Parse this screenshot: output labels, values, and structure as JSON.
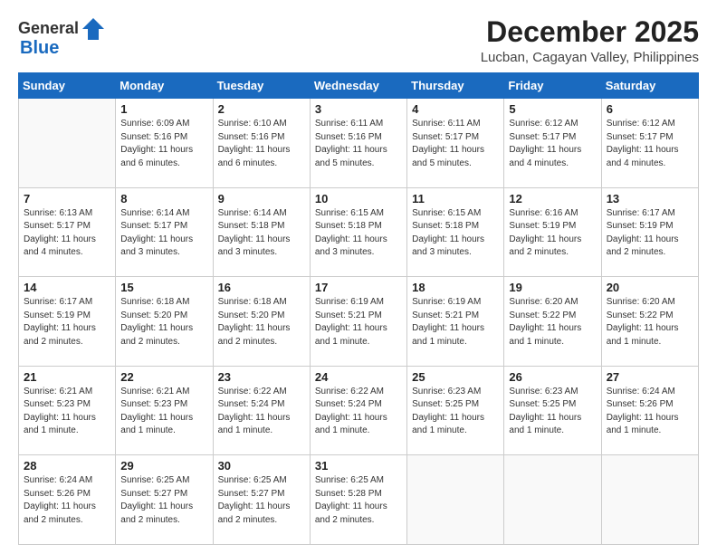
{
  "logo": {
    "general": "General",
    "blue": "Blue"
  },
  "title": "December 2025",
  "location": "Lucban, Cagayan Valley, Philippines",
  "weekdays": [
    "Sunday",
    "Monday",
    "Tuesday",
    "Wednesday",
    "Thursday",
    "Friday",
    "Saturday"
  ],
  "weeks": [
    [
      {
        "day": "",
        "info": ""
      },
      {
        "day": "1",
        "info": "Sunrise: 6:09 AM\nSunset: 5:16 PM\nDaylight: 11 hours\nand 6 minutes."
      },
      {
        "day": "2",
        "info": "Sunrise: 6:10 AM\nSunset: 5:16 PM\nDaylight: 11 hours\nand 6 minutes."
      },
      {
        "day": "3",
        "info": "Sunrise: 6:11 AM\nSunset: 5:16 PM\nDaylight: 11 hours\nand 5 minutes."
      },
      {
        "day": "4",
        "info": "Sunrise: 6:11 AM\nSunset: 5:17 PM\nDaylight: 11 hours\nand 5 minutes."
      },
      {
        "day": "5",
        "info": "Sunrise: 6:12 AM\nSunset: 5:17 PM\nDaylight: 11 hours\nand 4 minutes."
      },
      {
        "day": "6",
        "info": "Sunrise: 6:12 AM\nSunset: 5:17 PM\nDaylight: 11 hours\nand 4 minutes."
      }
    ],
    [
      {
        "day": "7",
        "info": "Sunrise: 6:13 AM\nSunset: 5:17 PM\nDaylight: 11 hours\nand 4 minutes."
      },
      {
        "day": "8",
        "info": "Sunrise: 6:14 AM\nSunset: 5:17 PM\nDaylight: 11 hours\nand 3 minutes."
      },
      {
        "day": "9",
        "info": "Sunrise: 6:14 AM\nSunset: 5:18 PM\nDaylight: 11 hours\nand 3 minutes."
      },
      {
        "day": "10",
        "info": "Sunrise: 6:15 AM\nSunset: 5:18 PM\nDaylight: 11 hours\nand 3 minutes."
      },
      {
        "day": "11",
        "info": "Sunrise: 6:15 AM\nSunset: 5:18 PM\nDaylight: 11 hours\nand 3 minutes."
      },
      {
        "day": "12",
        "info": "Sunrise: 6:16 AM\nSunset: 5:19 PM\nDaylight: 11 hours\nand 2 minutes."
      },
      {
        "day": "13",
        "info": "Sunrise: 6:17 AM\nSunset: 5:19 PM\nDaylight: 11 hours\nand 2 minutes."
      }
    ],
    [
      {
        "day": "14",
        "info": "Sunrise: 6:17 AM\nSunset: 5:19 PM\nDaylight: 11 hours\nand 2 minutes."
      },
      {
        "day": "15",
        "info": "Sunrise: 6:18 AM\nSunset: 5:20 PM\nDaylight: 11 hours\nand 2 minutes."
      },
      {
        "day": "16",
        "info": "Sunrise: 6:18 AM\nSunset: 5:20 PM\nDaylight: 11 hours\nand 2 minutes."
      },
      {
        "day": "17",
        "info": "Sunrise: 6:19 AM\nSunset: 5:21 PM\nDaylight: 11 hours\nand 1 minute."
      },
      {
        "day": "18",
        "info": "Sunrise: 6:19 AM\nSunset: 5:21 PM\nDaylight: 11 hours\nand 1 minute."
      },
      {
        "day": "19",
        "info": "Sunrise: 6:20 AM\nSunset: 5:22 PM\nDaylight: 11 hours\nand 1 minute."
      },
      {
        "day": "20",
        "info": "Sunrise: 6:20 AM\nSunset: 5:22 PM\nDaylight: 11 hours\nand 1 minute."
      }
    ],
    [
      {
        "day": "21",
        "info": "Sunrise: 6:21 AM\nSunset: 5:23 PM\nDaylight: 11 hours\nand 1 minute."
      },
      {
        "day": "22",
        "info": "Sunrise: 6:21 AM\nSunset: 5:23 PM\nDaylight: 11 hours\nand 1 minute."
      },
      {
        "day": "23",
        "info": "Sunrise: 6:22 AM\nSunset: 5:24 PM\nDaylight: 11 hours\nand 1 minute."
      },
      {
        "day": "24",
        "info": "Sunrise: 6:22 AM\nSunset: 5:24 PM\nDaylight: 11 hours\nand 1 minute."
      },
      {
        "day": "25",
        "info": "Sunrise: 6:23 AM\nSunset: 5:25 PM\nDaylight: 11 hours\nand 1 minute."
      },
      {
        "day": "26",
        "info": "Sunrise: 6:23 AM\nSunset: 5:25 PM\nDaylight: 11 hours\nand 1 minute."
      },
      {
        "day": "27",
        "info": "Sunrise: 6:24 AM\nSunset: 5:26 PM\nDaylight: 11 hours\nand 1 minute."
      }
    ],
    [
      {
        "day": "28",
        "info": "Sunrise: 6:24 AM\nSunset: 5:26 PM\nDaylight: 11 hours\nand 2 minutes."
      },
      {
        "day": "29",
        "info": "Sunrise: 6:25 AM\nSunset: 5:27 PM\nDaylight: 11 hours\nand 2 minutes."
      },
      {
        "day": "30",
        "info": "Sunrise: 6:25 AM\nSunset: 5:27 PM\nDaylight: 11 hours\nand 2 minutes."
      },
      {
        "day": "31",
        "info": "Sunrise: 6:25 AM\nSunset: 5:28 PM\nDaylight: 11 hours\nand 2 minutes."
      },
      {
        "day": "",
        "info": ""
      },
      {
        "day": "",
        "info": ""
      },
      {
        "day": "",
        "info": ""
      }
    ]
  ]
}
